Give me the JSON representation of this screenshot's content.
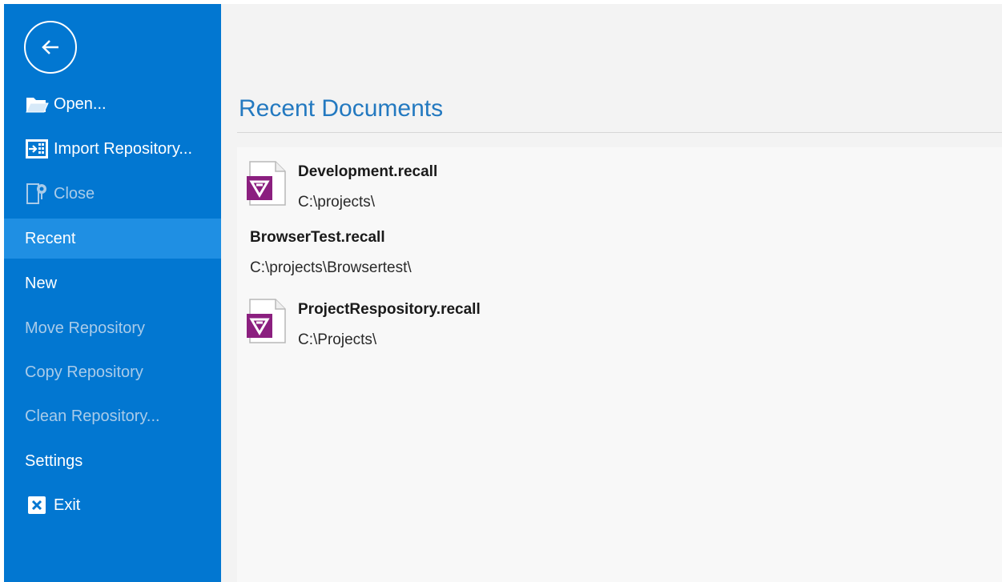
{
  "sidebar": {
    "items": [
      {
        "label": "Open...",
        "icon": "folder-open-icon",
        "state": "normal"
      },
      {
        "label": "Import Repository...",
        "icon": "import-icon",
        "state": "normal"
      },
      {
        "label": "Close",
        "icon": "close-document-icon",
        "state": "disabled"
      },
      {
        "label": "Recent",
        "state": "selected"
      },
      {
        "label": "New",
        "state": "normal"
      },
      {
        "label": "Move Repository",
        "state": "disabled"
      },
      {
        "label": "Copy Repository",
        "state": "disabled"
      },
      {
        "label": "Clean Repository...",
        "state": "disabled"
      },
      {
        "label": "Settings",
        "state": "normal"
      },
      {
        "label": "Exit",
        "icon": "exit-icon",
        "state": "normal"
      }
    ]
  },
  "main": {
    "title": "Recent Documents",
    "documents": [
      {
        "name": "Development.recall",
        "path": "C:\\projects\\",
        "icon": "recall-file-icon"
      },
      {
        "name": "BrowserTest.recall",
        "path": "C:\\projects\\Browsertest\\"
      },
      {
        "name": "ProjectRespository.recall",
        "path": "C:\\Projects\\",
        "icon": "recall-file-icon"
      }
    ]
  },
  "colors": {
    "sidebar_bg": "#0277d1",
    "selected_bg": "#1f8fe3",
    "title_blue": "#2379c0",
    "icon_purple": "#8b1f7f"
  }
}
